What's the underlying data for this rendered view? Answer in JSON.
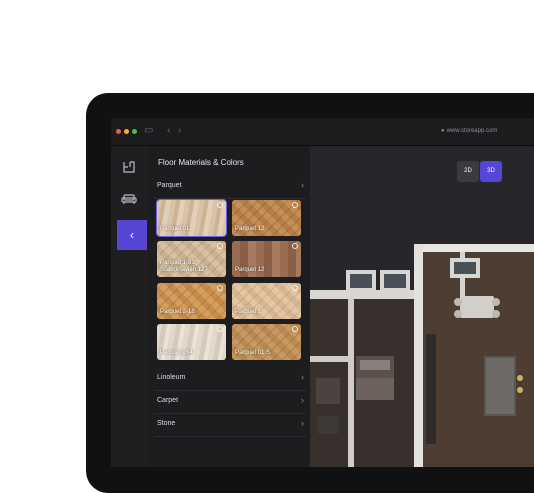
{
  "panel": {
    "title": "Floor Materials & Colors",
    "sections": [
      "Parquet",
      "Linoleum",
      "Carpet",
      "Stone"
    ]
  },
  "materials": [
    {
      "name": "Parquet 01",
      "selected": true
    },
    {
      "name": "Parquet 12"
    },
    {
      "name": "Parquet 1-81 Scandinavian 127"
    },
    {
      "name": "Parquet 12"
    },
    {
      "name": "Parquet 2-18"
    },
    {
      "name": "Parquet 1"
    },
    {
      "name": "Parquet 264"
    },
    {
      "name": "Parquet 01 S"
    }
  ],
  "view_modes": {
    "two_d": "2D",
    "three_d": "3D",
    "active": "3D"
  },
  "browser": {
    "url": "www.storeapp.com"
  },
  "icons": {
    "rail": [
      "floor-plan-icon",
      "sofa-icon",
      "back-chevron-icon"
    ],
    "browser": [
      "sidebar-toggle-icon",
      "back-icon",
      "forward-icon",
      "lock-icon"
    ]
  },
  "colors": {
    "accent": "#5546d6",
    "panel_bg": "#1d1d20",
    "viewport_bg": "#27262a"
  }
}
